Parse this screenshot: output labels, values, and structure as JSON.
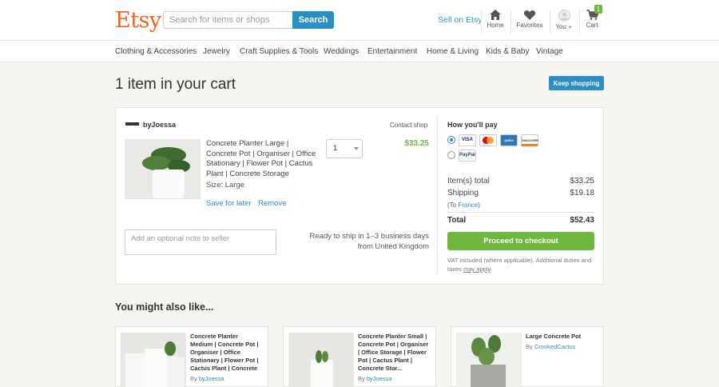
{
  "header": {
    "logo": "Etsy",
    "search_placeholder": "Search for items or shops",
    "search_button": "Search",
    "sell_link": "Sell on Etsy",
    "nav": {
      "home": "Home",
      "favorites": "Favorites",
      "you": "You",
      "cart": "Cart",
      "cart_count": "1"
    }
  },
  "categories": [
    "Clothing & Accessories",
    "Jewelry",
    "Craft Supplies & Tools",
    "Weddings",
    "Entertainment",
    "Home & Living",
    "Kids & Baby",
    "Vintage"
  ],
  "page": {
    "title": "1 item in your cart",
    "keep_shopping": "Keep shopping"
  },
  "cart": {
    "shop_name": "byJoessa",
    "contact_shop": "Contact shop",
    "item": {
      "title": "Concrete Planter Large | Concrete Pot | Organiser | Office Stationary | Flower Pot | Cactus Plant | Concrete Storage",
      "size": "Size: Large",
      "quantity": "1",
      "price": "$33.25",
      "save_for_later": "Save for later",
      "remove": "Remove"
    },
    "note_placeholder": "Add an optional note to seller",
    "shipping_info": "Ready to ship in 1–3 business days from United Kingdom"
  },
  "payment": {
    "heading": "How you'll pay",
    "cards": [
      "VISA",
      "MC",
      "AMEX",
      "DISCOVER"
    ],
    "paypal": "PayPal",
    "item_total_label": "Item(s) total",
    "item_total": "$33.25",
    "shipping_label": "Shipping",
    "shipping": "$19.18",
    "to_prefix": "(To ",
    "to_country": "France",
    "to_suffix": ")",
    "total_label": "Total",
    "total": "$52.43",
    "checkout_button": "Proceed to checkout",
    "vat_text": "VAT included (where applicable). Additional duties and taxes ",
    "vat_link": "may apply",
    "vat_end": "."
  },
  "recommendations": {
    "heading": "You might also like...",
    "by_label": "By",
    "items": [
      {
        "title": "Concrete Planter Medium | Concrete Pot | Organiser | Office Stationary | Flower Pot | Cactus Plant | Concrete",
        "shop": "byJoessa"
      },
      {
        "title": "Concrete Planter Small | Concrete Pot | Organiser | Office Storage | Flower Pot | Cactus Plant | Concrete Stor...",
        "shop": "byJoessa"
      },
      {
        "title": "Large Concrete Pot",
        "shop": "CrookedCactus"
      }
    ]
  },
  "colors": {
    "brand": "#f1641e",
    "link_blue": "#2b8fc5",
    "price_green": "#6fb83f"
  }
}
